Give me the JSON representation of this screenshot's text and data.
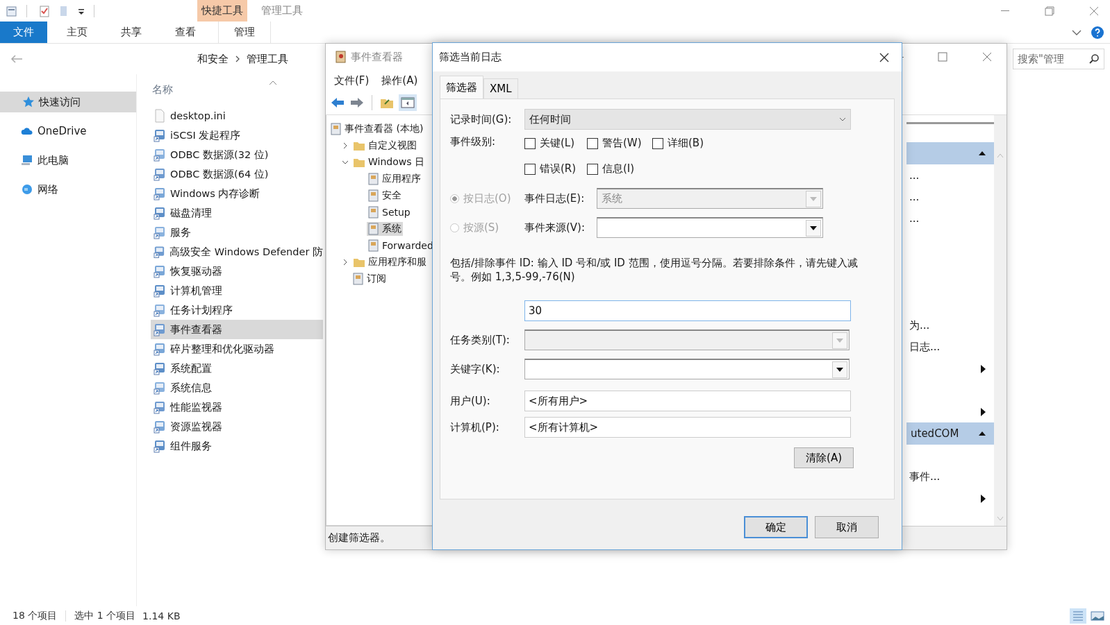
{
  "explorer": {
    "context_tab_group": "快捷工具",
    "title": "管理工具",
    "ribbon_tabs": [
      {
        "label": "文件",
        "selected": true
      },
      {
        "label": "主页",
        "selected": false
      },
      {
        "label": "共享",
        "selected": false
      },
      {
        "label": "查看",
        "selected": false
      },
      {
        "label": "管理",
        "selected": false
      }
    ],
    "breadcrumb": [
      "和安全",
      "管理工具"
    ],
    "search": {
      "placeholder": "搜索\"管理"
    },
    "nav_items": [
      {
        "label": "快速访问",
        "selected": true
      },
      {
        "label": "OneDrive",
        "selected": false
      },
      {
        "label": "此电脑",
        "selected": false
      },
      {
        "label": "网络",
        "selected": false
      }
    ],
    "column_header": "名称",
    "files": [
      {
        "name": "desktop.ini",
        "kind": "file",
        "selected": false
      },
      {
        "name": "iSCSI 发起程序",
        "kind": "shortcut",
        "selected": false
      },
      {
        "name": "ODBC 数据源(32 位)",
        "kind": "shortcut",
        "selected": false
      },
      {
        "name": "ODBC 数据源(64 位)",
        "kind": "shortcut",
        "selected": false
      },
      {
        "name": "Windows 内存诊断",
        "kind": "shortcut",
        "selected": false
      },
      {
        "name": "磁盘清理",
        "kind": "shortcut",
        "selected": false
      },
      {
        "name": "服务",
        "kind": "shortcut",
        "selected": false
      },
      {
        "name": "高级安全 Windows Defender 防",
        "kind": "shortcut",
        "selected": false
      },
      {
        "name": "恢复驱动器",
        "kind": "shortcut",
        "selected": false
      },
      {
        "name": "计算机管理",
        "kind": "shortcut",
        "selected": false
      },
      {
        "name": "任务计划程序",
        "kind": "shortcut",
        "selected": false
      },
      {
        "name": "事件查看器",
        "kind": "shortcut",
        "selected": true
      },
      {
        "name": "碎片整理和优化驱动器",
        "kind": "shortcut",
        "selected": false
      },
      {
        "name": "系统配置",
        "kind": "shortcut",
        "selected": false
      },
      {
        "name": "系统信息",
        "kind": "shortcut",
        "selected": false
      },
      {
        "name": "性能监视器",
        "kind": "shortcut",
        "selected": false
      },
      {
        "name": "资源监视器",
        "kind": "shortcut",
        "selected": false
      },
      {
        "name": "组件服务",
        "kind": "shortcut",
        "selected": false
      }
    ],
    "status": {
      "count": "18 个项目",
      "selection": "选中 1 个项目",
      "size": "1.14 KB"
    }
  },
  "event_viewer": {
    "title": "事件查看器",
    "menu": [
      "文件(F)",
      "操作(A)"
    ],
    "tree": [
      {
        "label": "事件查看器 (本地)",
        "selected": false,
        "children": [
          {
            "label": "自定义视图",
            "selected": false,
            "expanded": false
          },
          {
            "label": "Windows 日",
            "selected": false,
            "expanded": true,
            "children": [
              {
                "label": "应用程序",
                "selected": false
              },
              {
                "label": "安全",
                "selected": false
              },
              {
                "label": "Setup",
                "selected": false
              },
              {
                "label": "系统",
                "selected": true
              },
              {
                "label": "Forwarded",
                "selected": false
              }
            ]
          },
          {
            "label": "应用程序和服",
            "selected": false,
            "expanded": false
          },
          {
            "label": "订阅",
            "selected": false
          }
        ]
      }
    ],
    "actions": [
      {
        "kind": "header",
        "expanded": true
      },
      {
        "kind": "item",
        "label": "..."
      },
      {
        "kind": "item",
        "label": "..."
      },
      {
        "kind": "item",
        "label": "..."
      },
      {
        "kind": "blank"
      },
      {
        "kind": "blank"
      },
      {
        "kind": "blank"
      },
      {
        "kind": "blank"
      },
      {
        "kind": "item",
        "label": "为..."
      },
      {
        "kind": "item",
        "label": "日志..."
      },
      {
        "kind": "submenu"
      },
      {
        "kind": "blank"
      },
      {
        "kind": "submenu"
      },
      {
        "kind": "header",
        "label": "utedCOM",
        "expanded": true
      },
      {
        "kind": "blank"
      },
      {
        "kind": "item",
        "label": "事件..."
      },
      {
        "kind": "submenu"
      }
    ],
    "status": "创建筛选器。"
  },
  "filter_dialog": {
    "title": "筛选当前日志",
    "tabs": [
      {
        "label": "筛选器",
        "selected": true
      },
      {
        "label": "XML",
        "selected": false
      }
    ],
    "logged": {
      "label": "记录时间(G):",
      "value": "任何时间"
    },
    "event_level": {
      "label": "事件级别:",
      "options": [
        {
          "label": "关键(L)",
          "checked": false
        },
        {
          "label": "警告(W)",
          "checked": false
        },
        {
          "label": "详细(B)",
          "checked": false
        },
        {
          "label": "错误(R)",
          "checked": false
        },
        {
          "label": "信息(I)",
          "checked": false
        }
      ]
    },
    "sources": [
      {
        "label": "按日志(O)",
        "selected": true,
        "disabled": true,
        "field_label": "事件日志(E):",
        "value": "系统",
        "field_disabled": true
      },
      {
        "label": "按源(S)",
        "selected": false,
        "disabled": true,
        "field_label": "事件来源(V):",
        "field_disabled": false
      }
    ],
    "id_hint": "包括/排除事件 ID: 输入 ID 号和/或 ID 范围，使用逗号分隔。若要排除条件，请先键入减号。例如 1,3,5-99,-76(N)",
    "event_id": "30",
    "task_category": {
      "label": "任务类别(T):",
      "disabled": true
    },
    "keywords": {
      "label": "关键字(K):",
      "disabled": false
    },
    "user": {
      "label": "用户(U):",
      "value": "<所有用户>"
    },
    "computer": {
      "label": "计算机(P):",
      "value": "<所有计算机>"
    },
    "clear_button": "清除(A)",
    "buttons": [
      {
        "label": "确定",
        "default": true
      },
      {
        "label": "取消",
        "default": false
      }
    ]
  }
}
